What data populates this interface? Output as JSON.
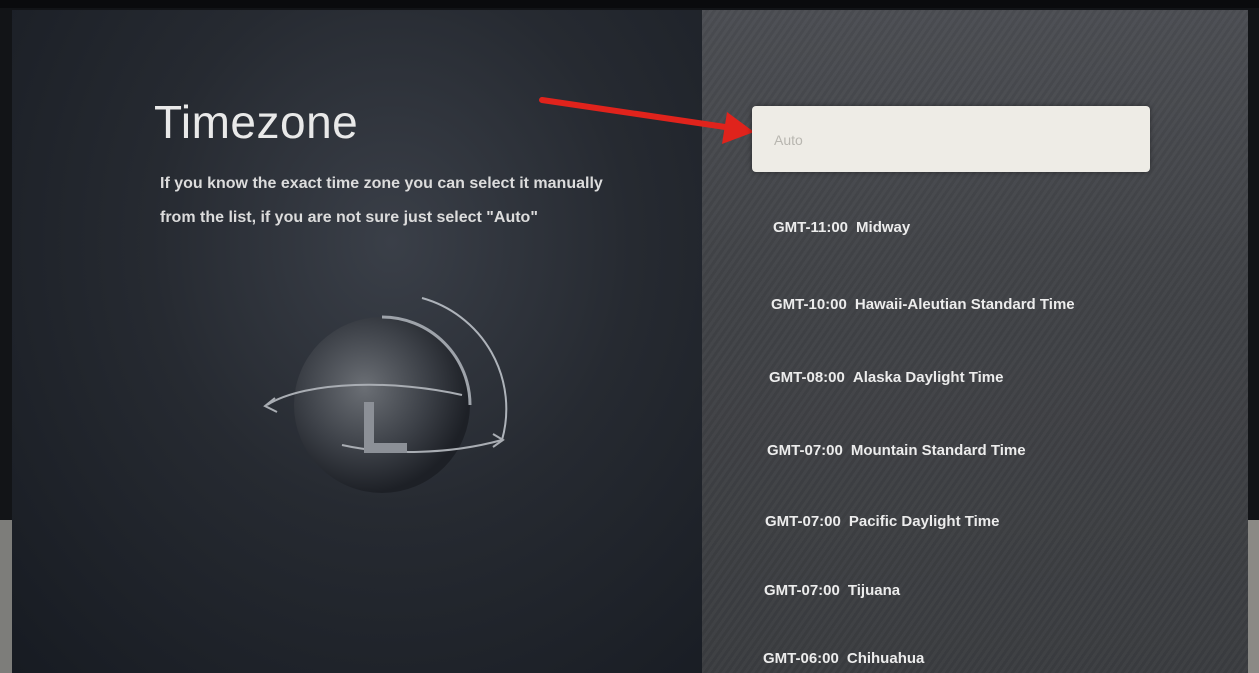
{
  "screen": {
    "title": "Timezone",
    "description_line1": "If you know the exact time zone you can select it manually",
    "description_line2": "from the list, if you are not sure just select \"Auto\""
  },
  "timezone_list": {
    "auto_option": "Auto",
    "items": [
      {
        "offset": "GMT-11:00",
        "name": "Midway"
      },
      {
        "offset": "GMT-10:00",
        "name": "Hawaii-Aleutian Standard Time"
      },
      {
        "offset": "GMT-08:00",
        "name": "Alaska Daylight Time"
      },
      {
        "offset": "GMT-07:00",
        "name": "Mountain Standard Time"
      },
      {
        "offset": "GMT-07:00",
        "name": "Pacific Daylight Time"
      },
      {
        "offset": "GMT-07:00",
        "name": "Tijuana"
      },
      {
        "offset": "GMT-06:00",
        "name": "Chihuahua"
      }
    ]
  },
  "annotation": {
    "arrow_color": "#e0231c",
    "arrow_icon": "red-arrow-icon"
  },
  "illustration": {
    "icon": "globe-clock-icon"
  }
}
